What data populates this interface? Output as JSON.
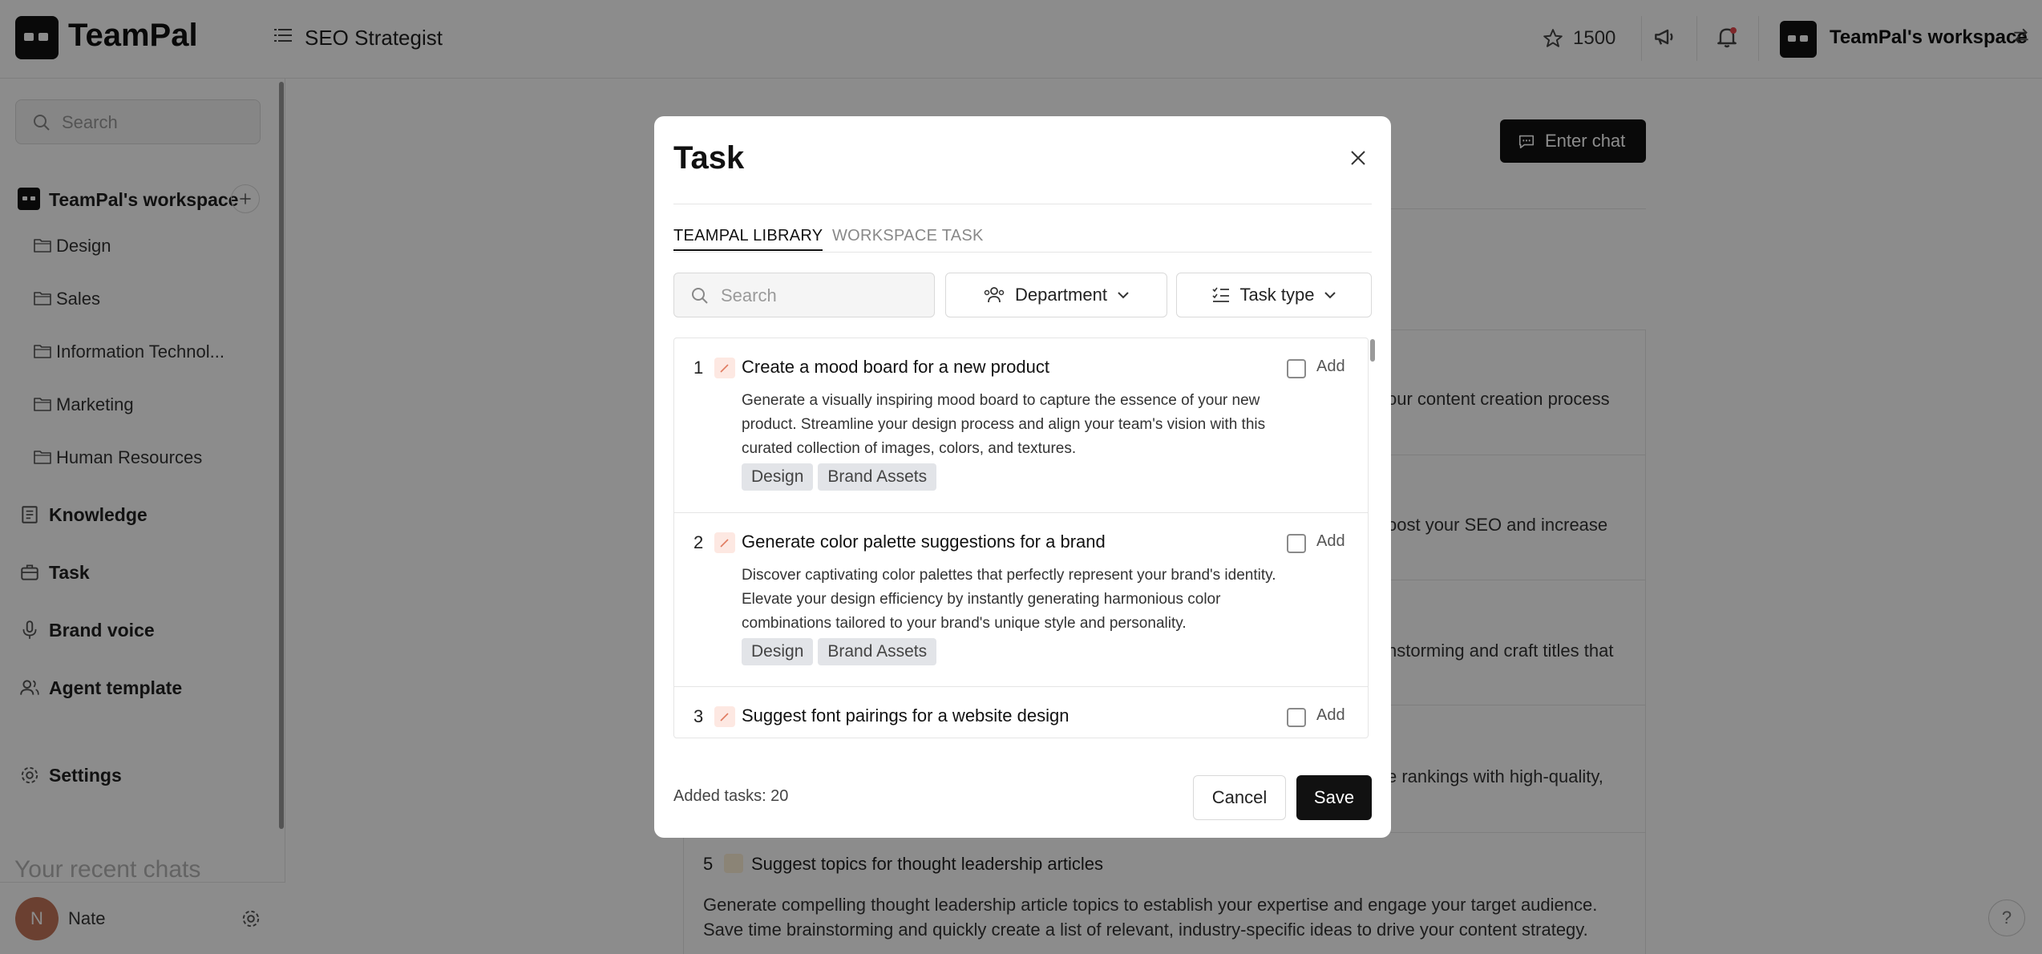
{
  "app": {
    "brand": "TeamPal",
    "page_title": "SEO Strategist"
  },
  "header": {
    "credits": "1500",
    "workspace_name": "TeamPal's workspace",
    "icons": [
      "menu-icon",
      "star-icon",
      "megaphone-icon",
      "bell-icon",
      "swap-icon"
    ]
  },
  "sidebar": {
    "search_placeholder": "Search",
    "workspace": "TeamPal's workspace",
    "folders": [
      "Design",
      "Sales",
      "Information Technol...",
      "Marketing",
      "Human Resources"
    ],
    "nav": [
      "Knowledge",
      "Task",
      "Brand voice",
      "Agent template",
      "Settings"
    ],
    "recent_chats_heading": "Your recent chats",
    "user": {
      "initial": "N",
      "name": "Nate"
    }
  },
  "main": {
    "enter_chat_label": "Enter chat",
    "fragments": [
      "our content creation process",
      "oost your SEO and increase",
      "nstorming and craft titles that",
      "e rankings with high-quality,"
    ],
    "item5": {
      "number": "5",
      "title": "Suggest topics for thought leadership articles",
      "description": "Generate compelling thought leadership article topics to establish your expertise and engage your target audience. Save time brainstorming and quickly create a list of relevant, industry-specific ideas to drive your content strategy."
    },
    "help_label": "?"
  },
  "modal": {
    "title": "Task",
    "tabs": [
      "TEAMPAL LIBRARY",
      "WORKSPACE TASK"
    ],
    "search_placeholder": "Search",
    "department_label": "Department",
    "task_type_label": "Task type",
    "add_label": "Add",
    "items": [
      {
        "number": "1",
        "title": "Create a mood board for a new product",
        "description": "Generate a visually inspiring mood board to capture the essence of your new product. Streamline your design process and align your team's vision with this curated collection of images, colors, and textures.",
        "tags": [
          "Design",
          "Brand Assets"
        ]
      },
      {
        "number": "2",
        "title": "Generate color palette suggestions for a brand",
        "description": "Discover captivating color palettes that perfectly represent your brand's identity. Elevate your design efficiency by instantly generating harmonious color combinations tailored to your brand's unique style and personality.",
        "tags": [
          "Design",
          "Brand Assets"
        ]
      },
      {
        "number": "3",
        "title": "Suggest font pairings for a website design",
        "description": "",
        "tags": []
      }
    ],
    "added_tasks": "Added tasks: 20",
    "cancel_label": "Cancel",
    "save_label": "Save"
  }
}
